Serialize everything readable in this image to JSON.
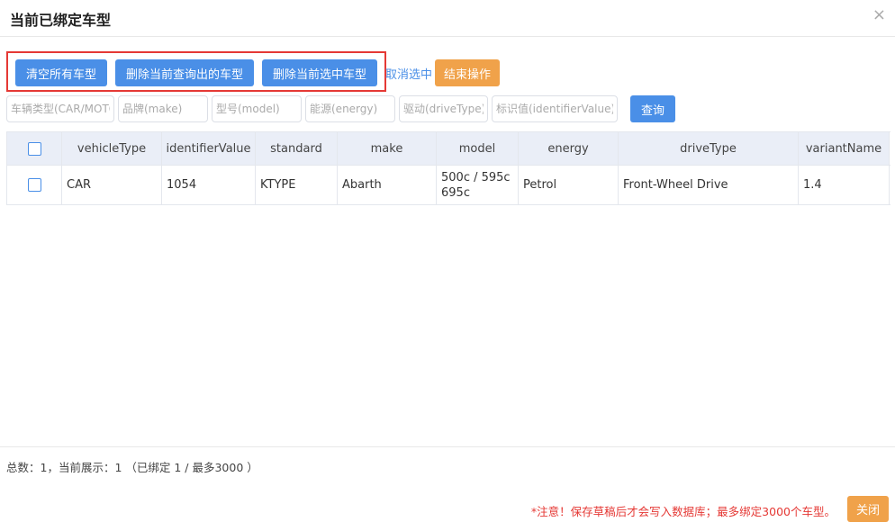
{
  "dialog": {
    "title": "当前已绑定车型",
    "close_icon": "×"
  },
  "toolbar": {
    "clear_all": "清空所有车型",
    "delete_queried": "删除当前查询出的车型",
    "delete_selected": "删除当前选中车型",
    "cancel_selection": "取消选中",
    "end_operation": "结束操作"
  },
  "filters": {
    "vehicle_type": "车辆类型(CAR/MOTO)",
    "make": "品牌(make)",
    "model": "型号(model)",
    "energy": "能源(energy)",
    "drive_type": "驱动(driveType)",
    "identifier": "标识值(identifierValue)",
    "query_button": "查询"
  },
  "table": {
    "columns": [
      "vehicleType",
      "identifierValue",
      "standard",
      "make",
      "model",
      "energy",
      "driveType",
      "variantName"
    ],
    "rows": [
      {
        "vehicleType": "CAR",
        "identifierValue": "1054",
        "standard": "KTYPE",
        "make": "Abarth",
        "model": "500c / 595c 695c",
        "energy": "Petrol",
        "driveType": "Front-Wheel Drive",
        "variantName": "1.4"
      }
    ]
  },
  "footer": {
    "summary": "总数：1，当前展示：1 （已绑定 1 / 最多3000 ）",
    "note": "*注意！保存草稿后才会写入数据库；最多绑定3000个车型。",
    "close_button": "关闭"
  },
  "colors": {
    "primary": "#4a8fe7",
    "warning": "#f0a24a",
    "danger": "#e53935",
    "header_bg": "#eaeef7"
  }
}
